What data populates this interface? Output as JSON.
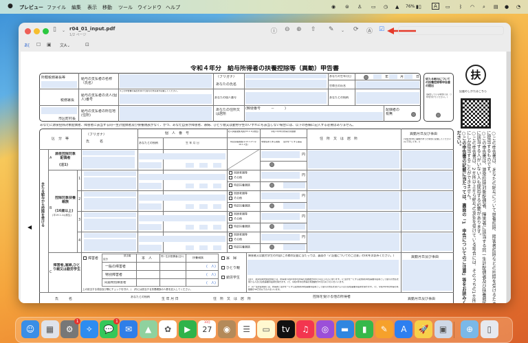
{
  "menubar": {
    "app": "プレビュー",
    "items": [
      "ファイル",
      "編集",
      "表示",
      "移動",
      "ツール",
      "ウインドウ",
      "ヘルプ"
    ],
    "battery": "76%",
    "input_mode": "A"
  },
  "window": {
    "title": "r04_01_input.pdf",
    "subtitle": "1/2 ページ",
    "accent": "#3b82f6",
    "arrow_color": "#e53a2a"
  },
  "form": {
    "title": "令和４年分　給与所得者の扶養控除等（異動）申告書",
    "office": [
      "所轄税務署長等",
      "税務署長",
      "市区町村長"
    ],
    "payer": [
      "給与の支払者の名称（氏名）",
      "給与の支払者の法人(個人)番号",
      "給与の支払者の所在地(住所)"
    ],
    "payer_note": "※この申告書の提出を受けた給与の支払者が記載してください。",
    "you": {
      "furigana": "（フリガナ）",
      "name": "あなたの氏名",
      "number": "あなたの個人番号",
      "address": "あなたの住所又は居所",
      "postal": "(郵便番号　　　－　　　)",
      "birth": "あなたの生年月日",
      "year": "年",
      "month": "月",
      "day": "日",
      "head": "世帯主の氏名",
      "relation": "あなたとの続柄",
      "spouse": "配偶者の有無"
    },
    "secondary": {
      "title": "従たる給与についての扶養控除等申告書の提出",
      "note": "(提出している場合には、○印を付けてください。)"
    },
    "seal": "扶",
    "howto": "記載のしかたはこちら",
    "notice": "あなたに源泉控除対象配偶者、障害者に該当する同一生計配偶者及び扶養親族がなく、かつ、あなた自身が障害者、寡婦、ひとり親又は勤労学生のいずれにも該当しない場合には、以下の各欄に記入する必要はありません。",
    "headers": {
      "kubun": "区　分　等",
      "furigana": "（フリガナ）",
      "name": "氏　　　名",
      "mynumber": "個　人　番　号",
      "relation": "あなたとの続柄",
      "birth": "生 年 月 日",
      "elderly": "老人扶養親族(昭和33.1.1以前生)",
      "specific": "特定扶養親族(平12.1.2〜平16.1.1生)",
      "income": "令和４年中の所得の見積額",
      "nonres": "非居住者である親族",
      "same": "生計を一にする事実",
      "address": "住　所　又　は　居　所",
      "change": "異動月日及び事由",
      "change_note": "(令和4年中に異動があった場合に記載してください(以下同じです。))"
    },
    "side_label": "主たる給与から控除を受ける",
    "rowA": {
      "code": "A",
      "label": "源泉控除対象配偶者",
      "note": "(注1)"
    },
    "rowB": {
      "code": "B",
      "label": "控除対象扶養親族",
      "age": "(16歳以上)",
      "born": "(平19.1.1以前生)",
      "nums": [
        "1",
        "2",
        "3",
        "4"
      ]
    },
    "checks": [
      "同居老親等",
      "その他",
      "特定扶養親族"
    ],
    "yen": "円",
    "rowC": {
      "code": "C",
      "label": "障害者,寡婦,ひとり親又は勤労学生",
      "disabled": "障害者",
      "gaitosha": "該当者",
      "kubun": "区分",
      "self": "本　人",
      "spouse": "同一生計配偶者(注2)",
      "dependent": "扶養親族",
      "types": [
        "一般の障害者",
        "特別障害者",
        "同居特別障害者"
      ],
      "count": "(　人)",
      "widow": "寡　婦",
      "single": "ひとり親",
      "student": "勤労学生",
      "content": "障害者又は勤労学生の内容(この欄の記載に当たっては、裏面の「2 記載についてのご注意」の(8)をお読みください。)",
      "change": "異動月日及び事由",
      "instr": "上の該当する項目及び欄にチェックを付け、(　)内には該当する扶養親族の人数を記入してください。"
    },
    "notes": [
      "(注)1　源泉控除対象配偶者とは、所得者(令和4年中の所得の見積額が900万円以下の人に限ります。)と生計を一にする配偶者(青色事業専従者として給与の支払を受ける人及び白色事業専従者を除きます。)で、令和4年中の所得の見積額が95万円以下の人をいいます。",
      "2　同一生計配偶者とは、所得者と生計を一にする配偶者(青色事業専従者として給与の支払を受ける人及び白色事業専従者を除きます。)で、令和4年中の所得の見積額が48万円以下の人をいいます。"
    ],
    "bottom": {
      "name": "氏　　　名",
      "relation": "あなたとの続柄",
      "birth": "生 年 月 日",
      "address": "住　所　又　は　居　所",
      "other": "控除を受ける他の所得者",
      "change": "異動月日及び事由"
    },
    "side_notes": [
      "○この申告書は、あなたの給与について扶養控除、障害者控除などの控除を受けるために提出するものです。",
      "○この申告書は、源泉控除対象配偶者、障害者に該当する同一生計配偶者及び扶養親族に該当する人がいない人も提出する必要があります。",
      "○この申告書は、2か所以上から給与の支払を受けている場合には、そのうちの1か所にしか提出することができません。",
      "○この申告書の記載に当たっては、裏面の「1　申告についてのご注意」等をお読みください。"
    ]
  },
  "dock": {
    "calendar_month": "10月",
    "calendar_day": "27",
    "badges": [
      "1",
      "1"
    ]
  }
}
